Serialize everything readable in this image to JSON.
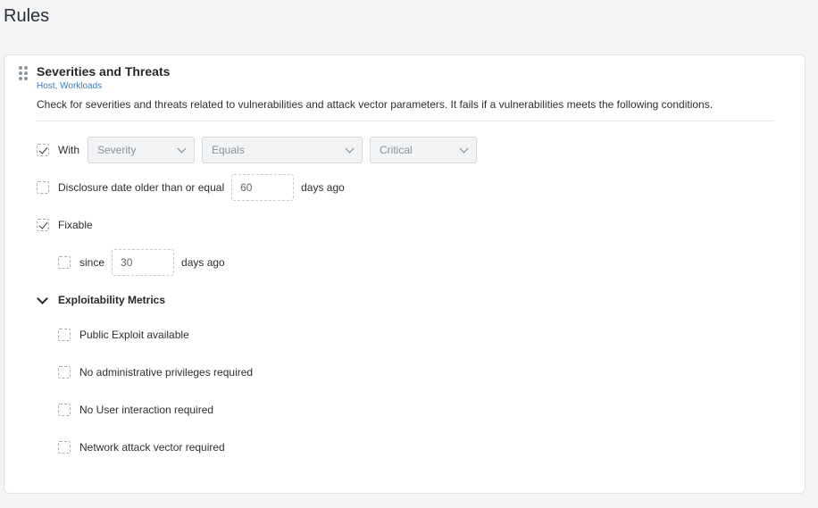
{
  "page": {
    "title": "Rules"
  },
  "card": {
    "title": "Severities and Threats",
    "subtitle": "Host, Workloads",
    "description": "Check for severities and threats related to vulnerabilities and attack vector parameters. It fails if a vulnerabilities meets the following conditions."
  },
  "conditions": {
    "with": {
      "checked": true,
      "label": "With",
      "field": "Severity",
      "operator": "Equals",
      "value": "Critical"
    },
    "disclosure": {
      "checked": false,
      "label": "Disclosure date older than or equal",
      "value": "60",
      "suffix": "days ago"
    },
    "fixable": {
      "checked": true,
      "label": "Fixable"
    },
    "since": {
      "checked": false,
      "label": "since",
      "value": "30",
      "suffix": "days ago"
    }
  },
  "exploitability": {
    "title": "Exploitability Metrics",
    "expanded": true,
    "items": [
      {
        "label": "Public Exploit available",
        "checked": false
      },
      {
        "label": "No administrative privileges required",
        "checked": false
      },
      {
        "label": "No User interaction required",
        "checked": false
      },
      {
        "label": "Network attack vector required",
        "checked": false
      }
    ]
  },
  "icons": {
    "drag": "drag-handle-icon",
    "check": "checkmark-icon",
    "dropdown": "chevron-down-icon"
  }
}
